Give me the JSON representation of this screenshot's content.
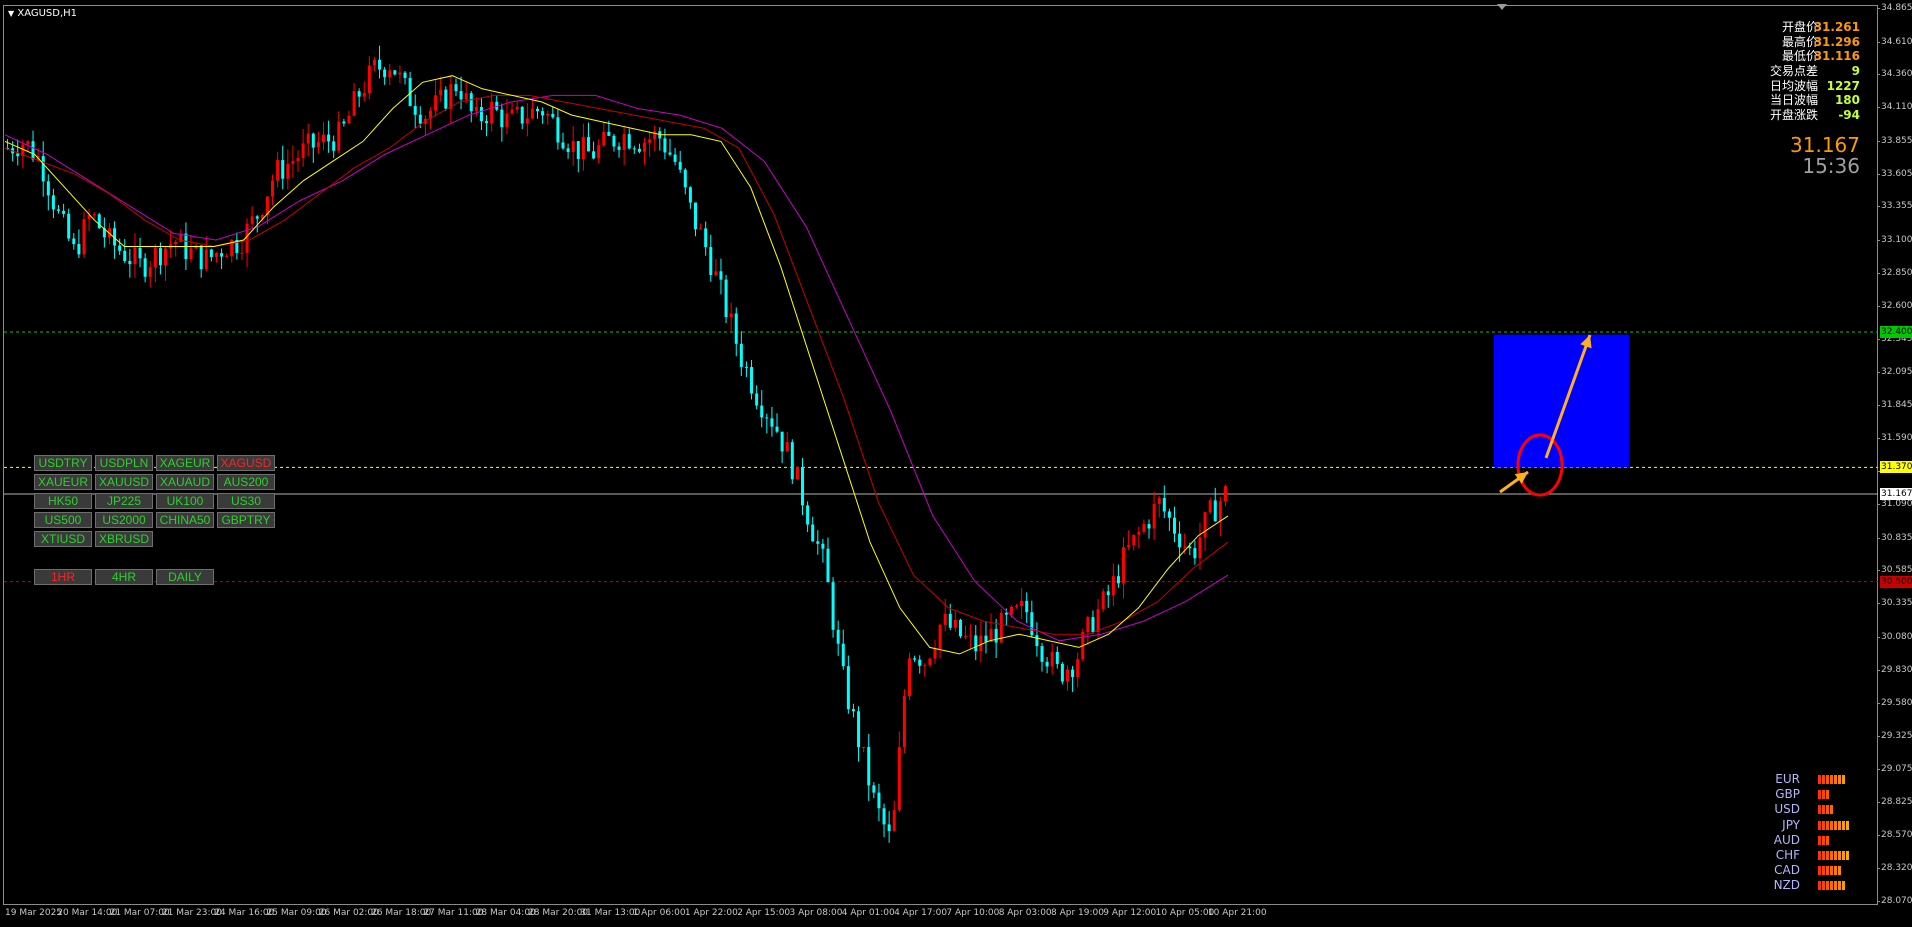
{
  "window": {
    "symbol_title": "XAGUSD,H1",
    "menu_icon": "triangle-down-icon"
  },
  "info_panel": {
    "rows": [
      {
        "label": "开盘价",
        "value": "31.261",
        "color": "#ff9900"
      },
      {
        "label": "最高价",
        "value": "31.296",
        "color": "#ff9900"
      },
      {
        "label": "最低价",
        "value": "31.116",
        "color": "#ff9900"
      },
      {
        "label": "交易点差",
        "value": "9",
        "color": "#c8ff32"
      },
      {
        "label": "日均波幅",
        "value": "1227",
        "color": "#c8ff32"
      },
      {
        "label": "当日波幅",
        "value": "180",
        "color": "#c8ff32"
      },
      {
        "label": "开盘涨跌",
        "value": "-94",
        "color": "#c8ff32"
      }
    ],
    "current_price": "31.167",
    "countdown": "15:36"
  },
  "symbol_buttons": [
    [
      "USDTRY",
      "USDPLN",
      "XAGEUR",
      "XAGUSD"
    ],
    [
      "XAUEUR",
      "XAUUSD",
      "XAUAUD",
      "AUS200"
    ],
    [
      "HK50",
      "JP225",
      "UK100",
      "US30"
    ],
    [
      "US500",
      "US2000",
      "CHINA50",
      "GBPTRY"
    ],
    [
      "XTIUSD",
      "XBRUSD"
    ]
  ],
  "active_symbol": "XAGUSD",
  "timeframe_buttons": [
    "1HR",
    "4HR",
    "DAILY"
  ],
  "active_timeframe": "1HR",
  "currency_strength": [
    {
      "name": "EUR",
      "level": 7
    },
    {
      "name": "GBP",
      "level": 3
    },
    {
      "name": "USD",
      "level": 4
    },
    {
      "name": "JPY",
      "level": 8
    },
    {
      "name": "AUD",
      "level": 3
    },
    {
      "name": "CHF",
      "level": 8
    },
    {
      "name": "CAD",
      "level": 6
    },
    {
      "name": "NZD",
      "level": 7
    }
  ],
  "chart_data": {
    "type": "candlestick",
    "symbol": "XAGUSD",
    "timeframe": "H1",
    "ylim": [
      28.07,
      34.865
    ],
    "price_ticks": [
      "34.865",
      "34.610",
      "34.360",
      "34.110",
      "33.855",
      "33.605",
      "33.355",
      "33.100",
      "32.850",
      "32.600",
      "32.345",
      "32.095",
      "31.845",
      "31.590",
      "31.340",
      "31.090",
      "30.835",
      "30.585",
      "30.335",
      "30.080",
      "29.830",
      "29.580",
      "29.325",
      "29.075",
      "28.825",
      "28.570",
      "28.320",
      "28.070"
    ],
    "time_ticks": [
      "19 Mar 2025",
      "20 Mar 14:00",
      "21 Mar 07:00",
      "21 Mar 23:00",
      "24 Mar 16:00",
      "25 Mar 09:00",
      "26 Mar 02:00",
      "26 Mar 18:00",
      "27 Mar 11:00",
      "28 Mar 04:00",
      "28 Mar 20:00",
      "31 Mar 13:00",
      "1 Apr 06:00",
      "1 Apr 22:00",
      "2 Apr 15:00",
      "3 Apr 08:00",
      "4 Apr 01:00",
      "4 Apr 17:00",
      "7 Apr 10:00",
      "8 Apr 03:00",
      "8 Apr 19:00",
      "9 Apr 12:00",
      "10 Apr 05:00",
      "10 Apr 21:00"
    ],
    "close_path": [
      33.8,
      33.85,
      33.7,
      33.3,
      33.0,
      33.3,
      33.1,
      33.0,
      32.9,
      33.0,
      33.1,
      33.0,
      32.95,
      33.05,
      33.1,
      33.3,
      33.6,
      33.7,
      33.8,
      33.85,
      33.9,
      34.2,
      34.4,
      34.45,
      34.2,
      34.05,
      34.15,
      34.3,
      34.0,
      34.1,
      34.0,
      34.05,
      34.1,
      33.95,
      33.8,
      33.75,
      33.85,
      33.9,
      33.85,
      33.9,
      33.7,
      33.3,
      33.0,
      32.6,
      32.2,
      31.9,
      31.7,
      31.4,
      31.0,
      30.6,
      29.8,
      29.3,
      28.8,
      28.5,
      30.0,
      29.9,
      30.2,
      30.1,
      30.0,
      30.1,
      30.2,
      30.3,
      30.0,
      29.8,
      29.9,
      30.2,
      30.4,
      30.7,
      30.9,
      31.1,
      30.9,
      30.7,
      31.0,
      31.17
    ],
    "ma_fast": [
      33.85,
      33.75,
      33.5,
      33.25,
      33.05,
      33.05,
      33.05,
      33.05,
      33.1,
      33.35,
      33.55,
      33.7,
      33.85,
      34.1,
      34.3,
      34.35,
      34.25,
      34.2,
      34.15,
      34.05,
      34.0,
      33.95,
      33.9,
      33.9,
      33.85,
      33.5,
      32.9,
      32.2,
      31.5,
      30.8,
      30.3,
      30.0,
      29.95,
      30.05,
      30.1,
      30.05,
      30.0,
      30.1,
      30.3,
      30.6,
      30.85,
      31.0
    ],
    "ma_mid": [
      33.8,
      33.7,
      33.6,
      33.45,
      33.25,
      33.1,
      33.05,
      33.1,
      33.25,
      33.45,
      33.65,
      33.8,
      34.0,
      34.15,
      34.2,
      34.2,
      34.15,
      34.1,
      34.05,
      34.0,
      33.95,
      33.8,
      33.3,
      32.6,
      31.9,
      31.1,
      30.55,
      30.3,
      30.2,
      30.15,
      30.1,
      30.1,
      30.2,
      30.35,
      30.6,
      30.8
    ],
    "ma_slow": [
      33.9,
      33.75,
      33.55,
      33.35,
      33.15,
      33.1,
      33.2,
      33.4,
      33.55,
      33.75,
      33.9,
      34.05,
      34.15,
      34.2,
      34.2,
      34.1,
      34.05,
      33.95,
      33.7,
      33.2,
      32.5,
      31.8,
      31.0,
      30.5,
      30.2,
      30.05,
      30.1,
      30.2,
      30.35,
      30.55
    ],
    "horizontal_levels": [
      {
        "price": "32.400",
        "color": "#00c800",
        "style": "dashed"
      },
      {
        "price": "31.370",
        "color": "#ffff00",
        "style": "dashed"
      },
      {
        "price": "31.167",
        "color": "#b4b4b4",
        "style": "solid"
      },
      {
        "price": "30.500",
        "color": "#c80000",
        "style": "dashed"
      }
    ],
    "target_box": {
      "price_top": 32.38,
      "price_bottom": 31.37,
      "color": "#0000ff"
    },
    "colors": {
      "up_candle": "#ff0000",
      "down_candle": "#00ffff",
      "ma_fast": "#ffff00",
      "ma_mid": "#c80000",
      "ma_slow": "#c800c8",
      "arrow": "#ffb020",
      "circle": "#ff0000"
    }
  }
}
